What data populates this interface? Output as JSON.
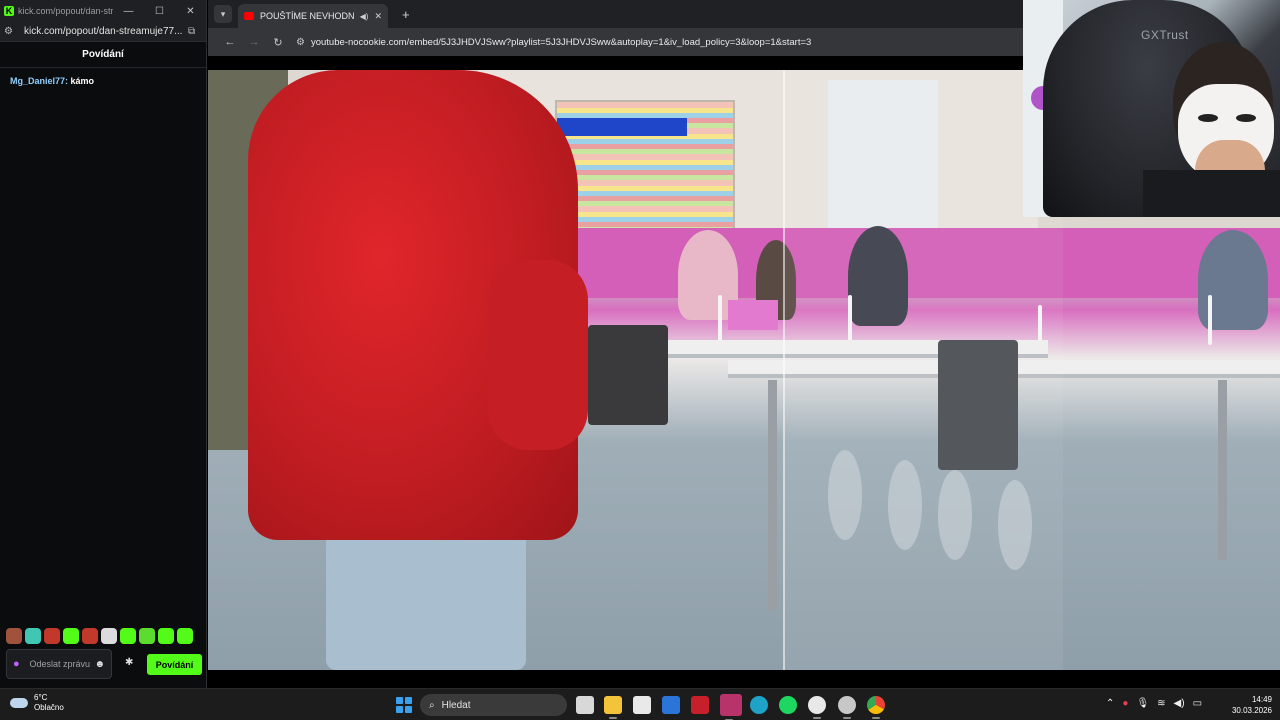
{
  "chat_window": {
    "title": "kick.com/popout/dan-stre...",
    "url": "kick.com/popout/dan-streamuje77...",
    "header": "Povídání",
    "messages": [
      {
        "user": "Mg_Daniel77:",
        "text": " kámo"
      }
    ],
    "input_placeholder": "Odeslat zprávu",
    "send_label": "Povídání",
    "accent_color": "#53fc18"
  },
  "browser": {
    "tab_title": "POUŠTÍME NEVHODNÉ PÍS",
    "url": "youtube-nocookie.com/embed/5J3JHDVJSww?playlist=5J3JHDVJSww&autoplay=1&iv_load_policy=3&loop=1&start=3"
  },
  "webcam": {
    "chair_brand": "GXTrust"
  },
  "taskbar": {
    "weather_temp": "6°C",
    "weather_desc": "Oblačno",
    "search_placeholder": "Hledat",
    "time": "14:49",
    "date": "30.03.2026",
    "apps": [
      "file-explorer",
      "folder",
      "store",
      "visual-studio",
      "mcafee",
      "app",
      "edge",
      "spotify",
      "obs",
      "steam",
      "chrome"
    ]
  }
}
